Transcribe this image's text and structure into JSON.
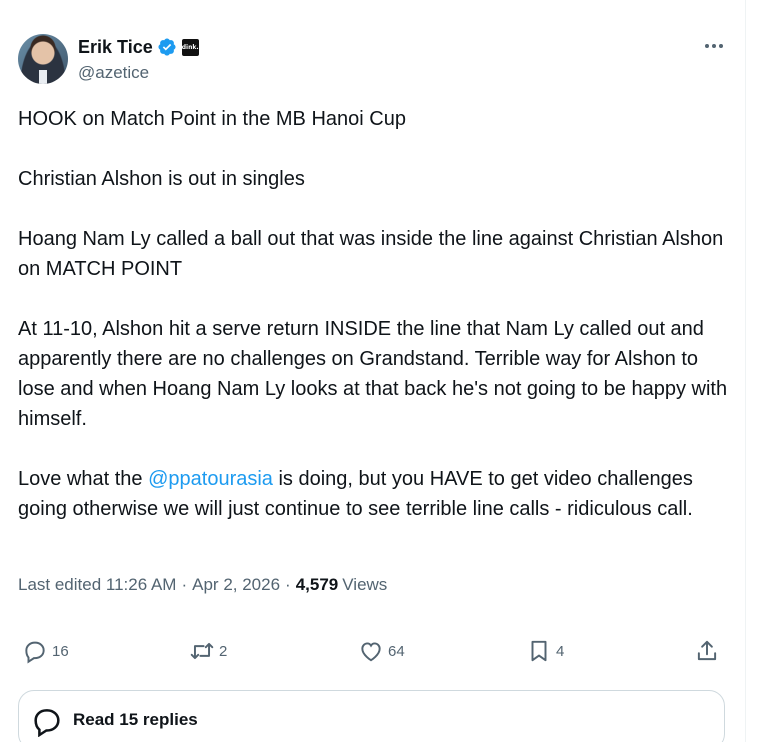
{
  "author": {
    "display_name": "Erik Tice",
    "handle": "@azetice",
    "affiliate_badge_text": "dink.",
    "verified_color": "#1d9bf0"
  },
  "tweet": {
    "paragraphs": [
      "HOOK on Match Point in the MB Hanoi Cup",
      "Christian Alshon is out in singles",
      "Hoang Nam Ly called a ball out that was inside the line against Christian Alshon on MATCH POINT",
      "At 11-10, Alshon hit a serve return INSIDE the line that Nam Ly called out and apparently there are no challenges on Grandstand. Terrible way for Alshon to lose and when Hoang Nam Ly looks at that back he's not going to be happy with himself."
    ],
    "last_paragraph": {
      "before": "Love what the ",
      "mention": "@ppatourasia",
      "after": " is doing, but you HAVE to get video challenges going otherwise we will just continue to see terrible line calls - ridiculous call."
    },
    "mention_color": "#1d9bf0"
  },
  "meta": {
    "edited_label": "Last edited 11:26 AM",
    "separator": "·",
    "date": "Apr 2, 2026",
    "views_count": "4,579",
    "views_label": "Views"
  },
  "actions": {
    "replies": "16",
    "reposts": "2",
    "likes": "64",
    "bookmarks": "4"
  },
  "icons": {
    "reply": "reply-icon",
    "repost": "repost-icon",
    "like": "heart-icon",
    "bookmark": "bookmark-icon",
    "share": "share-icon",
    "more": "more-icon",
    "verified": "verified-badge-icon"
  },
  "read_replies": {
    "label": "Read 15 replies"
  }
}
